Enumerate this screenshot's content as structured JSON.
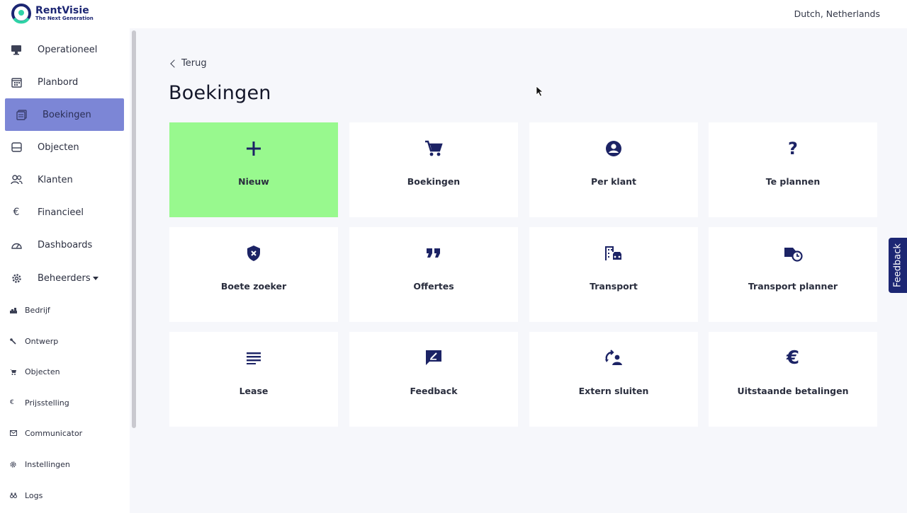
{
  "brand": {
    "name": "RentVisie",
    "tagline": "The Next Generation"
  },
  "locale": "Dutch, Netherlands",
  "sidebar": {
    "items": [
      {
        "label": "Operationeel",
        "icon": "monitor-icon"
      },
      {
        "label": "Planbord",
        "icon": "calendar-icon"
      },
      {
        "label": "Boekingen",
        "icon": "bookings-icon",
        "active": true
      },
      {
        "label": "Objecten",
        "icon": "inbox-icon"
      },
      {
        "label": "Klanten",
        "icon": "users-icon"
      },
      {
        "label": "Financieel",
        "icon": "euro-icon"
      },
      {
        "label": "Dashboards",
        "icon": "gauge-icon"
      },
      {
        "label": "Beheerders",
        "icon": "gear-icon"
      }
    ],
    "sub_items": [
      {
        "label": "Bedrijf",
        "icon": "chart-icon"
      },
      {
        "label": "Ontwerp",
        "icon": "wrench-icon"
      },
      {
        "label": "Objecten",
        "icon": "cart-icon"
      },
      {
        "label": "Prijsstelling",
        "icon": "euro-icon"
      },
      {
        "label": "Communicator",
        "icon": "mail-icon"
      },
      {
        "label": "Instellingen",
        "icon": "gear-icon"
      },
      {
        "label": "Logs",
        "icon": "binoculars-icon"
      }
    ]
  },
  "main": {
    "back_label": "Terug",
    "title": "Boekingen",
    "tiles": [
      {
        "label": "Nieuw",
        "icon": "plus-icon"
      },
      {
        "label": "Boekingen",
        "icon": "cart-icon"
      },
      {
        "label": "Per klant",
        "icon": "user-circle-icon"
      },
      {
        "label": "Te plannen",
        "icon": "question-icon"
      },
      {
        "label": "Boete zoeker",
        "icon": "shield-x-icon"
      },
      {
        "label": "Offertes",
        "icon": "quote-icon"
      },
      {
        "label": "Transport",
        "icon": "building-car-icon"
      },
      {
        "label": "Transport planner",
        "icon": "truck-clock-icon"
      },
      {
        "label": "Lease",
        "icon": "lines-icon"
      },
      {
        "label": "Feedback",
        "icon": "feedback-icon"
      },
      {
        "label": "Extern sluiten",
        "icon": "extern-icon"
      },
      {
        "label": "Uitstaande betalingen",
        "icon": "euro-icon"
      }
    ]
  },
  "feedback_tab": "Feedback",
  "colors": {
    "accent": "#7c86d6",
    "primary_tile": "#98f98e",
    "brand": "#1c2673"
  }
}
